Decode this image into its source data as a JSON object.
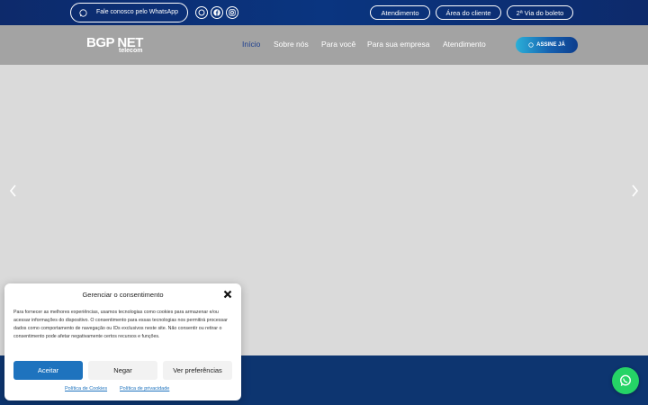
{
  "topbar": {
    "whatsapp_label": "Fale conosco pelo WhatsApp",
    "social_icons": [
      "whatsapp-icon",
      "facebook-icon",
      "instagram-icon"
    ],
    "links": [
      "Atendimento",
      "Área do cliente",
      "2ª Via do boleto"
    ]
  },
  "header": {
    "logo_main": "BGP NET",
    "logo_sub": "telecom",
    "nav": [
      "Início",
      "Sobre nós",
      "Para você",
      "Para sua empresa",
      "Atendimento"
    ],
    "active_nav": "Início",
    "subscribe_label": "ASSINE JÁ"
  },
  "consent": {
    "title": "Gerenciar o consentimento",
    "body": "Para fornecer as melhores experiências, usamos tecnologias como cookies para armazenar e/ou acessar informações do dispositivo. O consentimento para essas tecnologias nos permitirá processar dados como comportamento de navegação ou IDs exclusivos neste site. Não consentir ou retirar o consentimento pode afetar negativamente certos recursos e funções.",
    "accept_label": "Aceitar",
    "deny_label": "Negar",
    "prefs_label": "Ver preferências",
    "cookie_policy_label": "Política de Cookies",
    "privacy_policy_label": "Política de privacidade"
  },
  "colors": {
    "topbar": "#0a3580",
    "header": "#a3a3a3",
    "accent": "#1e73be",
    "active_nav": "#1d3f8f",
    "whatsapp": "#25d366",
    "footer_band": "#0d3570"
  }
}
